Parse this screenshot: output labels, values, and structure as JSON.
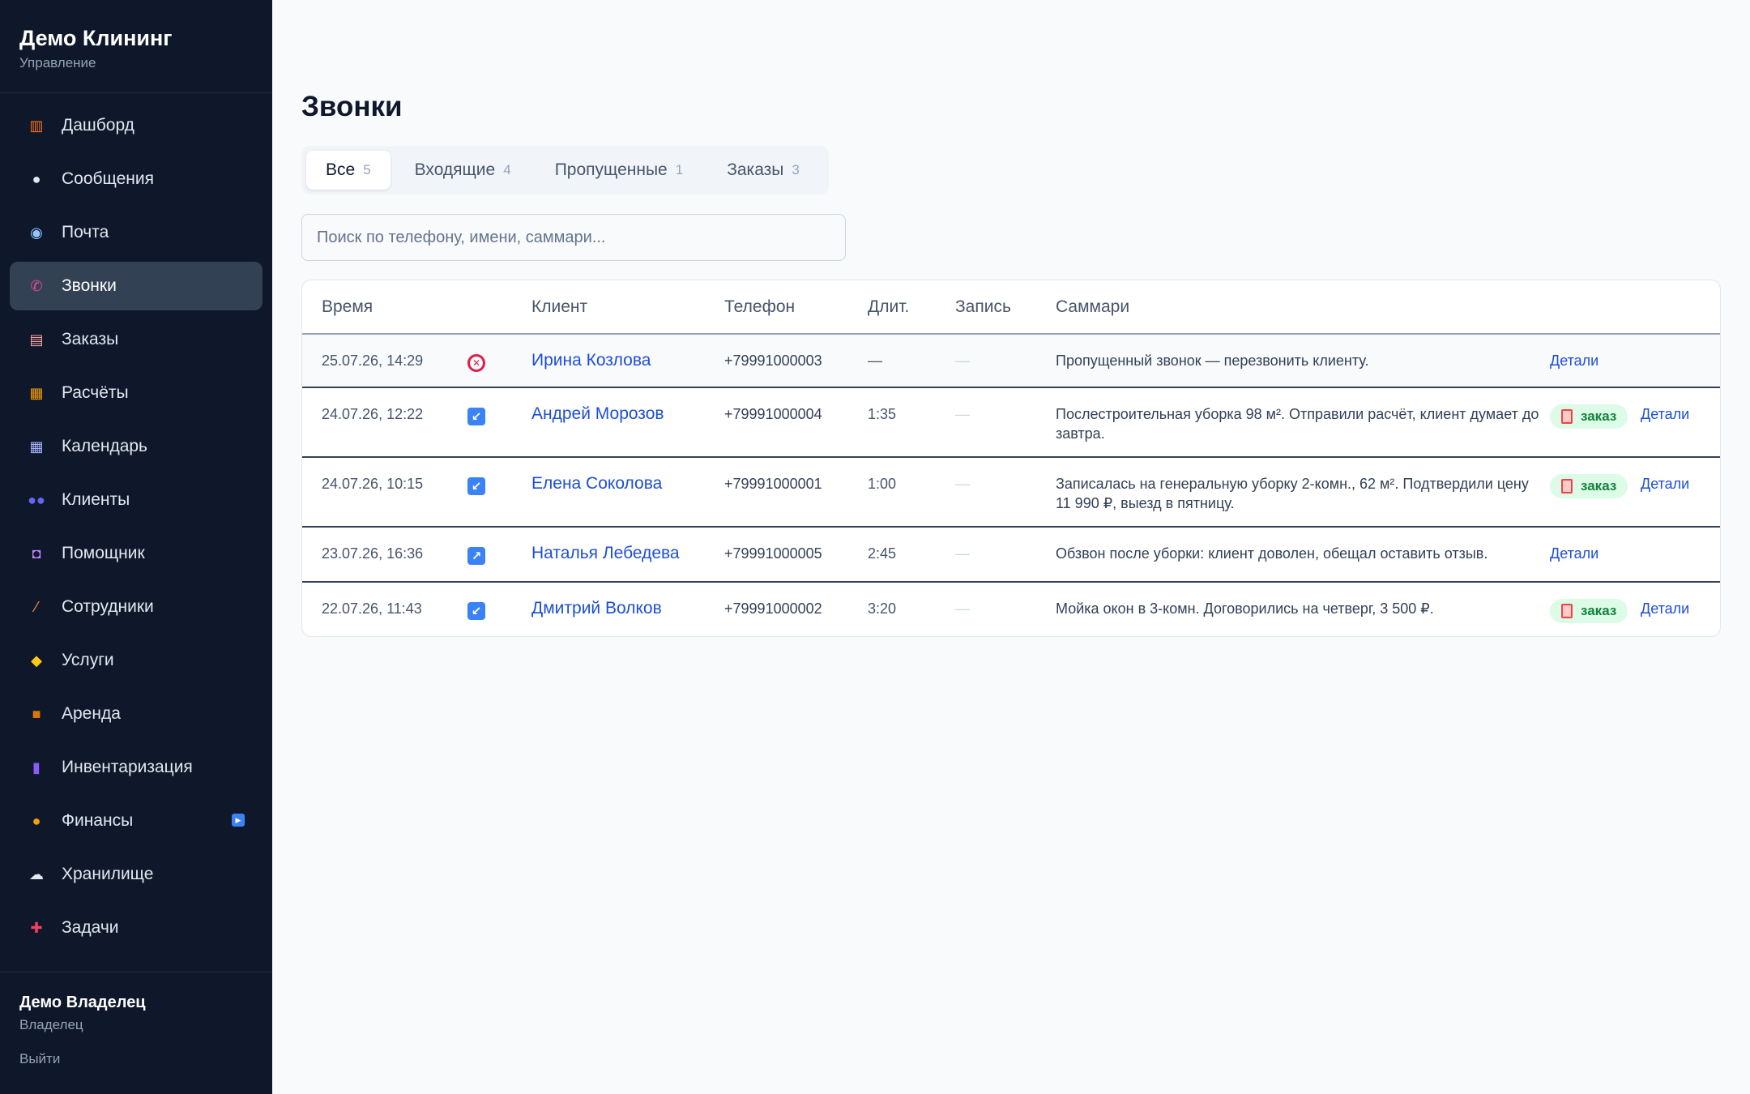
{
  "brand": {
    "title": "Демо Клининг",
    "subtitle": "Управление"
  },
  "sidebar": {
    "items": [
      {
        "label": "Дашборд",
        "icon": "bar-chart-icon",
        "glyph": "▥",
        "color": "#f97316"
      },
      {
        "label": "Сообщения",
        "icon": "speech-bubble-icon",
        "glyph": "●",
        "color": "#e2e8f0"
      },
      {
        "label": "Почта",
        "icon": "mail-icon",
        "glyph": "◉",
        "color": "#93c5fd"
      },
      {
        "label": "Звонки",
        "icon": "phone-icon",
        "glyph": "✆",
        "color": "#ec4899",
        "active": true
      },
      {
        "label": "Заказы",
        "icon": "clipboard-icon",
        "glyph": "▤",
        "color": "#fca5a5"
      },
      {
        "label": "Расчёты",
        "icon": "abacus-icon",
        "glyph": "▦",
        "color": "#f59e0b"
      },
      {
        "label": "Календарь",
        "icon": "calendar-icon",
        "glyph": "▦",
        "color": "#a5b4fc"
      },
      {
        "label": "Клиенты",
        "icon": "people-icon",
        "glyph": "●●",
        "color": "#6366f1"
      },
      {
        "label": "Помощник",
        "icon": "robot-icon",
        "glyph": "◘",
        "color": "#c084fc"
      },
      {
        "label": "Сотрудники",
        "icon": "broom-icon",
        "glyph": "⁄",
        "color": "#fb923c"
      },
      {
        "label": "Услуги",
        "icon": "tag-icon",
        "glyph": "◆",
        "color": "#facc15"
      },
      {
        "label": "Аренда",
        "icon": "box-icon",
        "glyph": "■",
        "color": "#d97706"
      },
      {
        "label": "Инвентаризация",
        "icon": "storage-icon",
        "glyph": "▮",
        "color": "#8b5cf6"
      },
      {
        "label": "Финансы",
        "icon": "money-bag-icon",
        "glyph": "●",
        "color": "#f59e0b",
        "badge": "▶"
      },
      {
        "label": "Хранилище",
        "icon": "cloud-icon",
        "glyph": "☁",
        "color": "#e2e8f0"
      },
      {
        "label": "Задачи",
        "icon": "pin-icon",
        "glyph": "✚",
        "color": "#f43f5e"
      }
    ]
  },
  "user": {
    "name": "Демо Владелец",
    "role": "Владелец",
    "logout": "Выйти"
  },
  "page": {
    "title": "Звонки"
  },
  "tabs": [
    {
      "label": "Все",
      "count": "5",
      "active": true
    },
    {
      "label": "Входящие",
      "count": "4"
    },
    {
      "label": "Пропущенные",
      "count": "1"
    },
    {
      "label": "Заказы",
      "count": "3"
    }
  ],
  "search": {
    "placeholder": "Поиск по телефону, имени, саммари..."
  },
  "table": {
    "headers": {
      "time": "Время",
      "client": "Клиент",
      "phone": "Телефон",
      "duration": "Длит.",
      "record": "Запись",
      "summary": "Саммари"
    },
    "rows": [
      {
        "time": "25.07.26, 14:29",
        "direction": "missed",
        "client": "Ирина Козлова",
        "phone": "+79991000003",
        "duration": "—",
        "record": "—",
        "summary": "Пропущенный звонок — перезвонить клиенту.",
        "order": false,
        "details": "Детали"
      },
      {
        "time": "24.07.26, 12:22",
        "direction": "incoming",
        "client": "Андрей Морозов",
        "phone": "+79991000004",
        "duration": "1:35",
        "record": "—",
        "summary": "Послестроительная уборка 98 м². Отправили расчёт, клиент думает до завтра.",
        "order": true,
        "order_label": "заказ",
        "details": "Детали"
      },
      {
        "time": "24.07.26, 10:15",
        "direction": "incoming",
        "client": "Елена Соколова",
        "phone": "+79991000001",
        "duration": "1:00",
        "record": "—",
        "summary": "Записалась на генеральную уборку 2-комн., 62 м². Подтвердили цену 11 990 ₽, выезд в пятницу.",
        "order": true,
        "order_label": "заказ",
        "details": "Детали"
      },
      {
        "time": "23.07.26, 16:36",
        "direction": "outgoing",
        "client": "Наталья Лебедева",
        "phone": "+79991000005",
        "duration": "2:45",
        "record": "—",
        "summary": "Обзвон после уборки: клиент доволен, обещал оставить отзыв.",
        "order": false,
        "details": "Детали"
      },
      {
        "time": "22.07.26, 11:43",
        "direction": "incoming",
        "client": "Дмитрий Волков",
        "phone": "+79991000002",
        "duration": "3:20",
        "record": "—",
        "summary": "Мойка окон в 3-комн. Договорились на четверг, 3 500 ₽.",
        "order": true,
        "order_label": "заказ",
        "details": "Детали"
      }
    ]
  }
}
